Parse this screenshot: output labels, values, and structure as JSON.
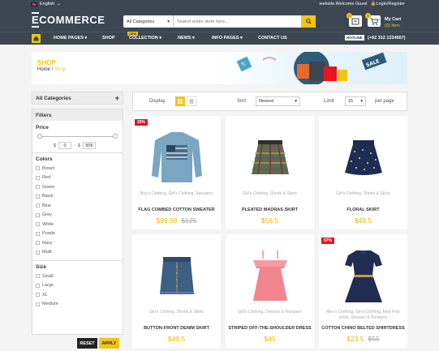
{
  "topbar": {
    "language": "English",
    "welcome": "website.Welcome Guest",
    "login": "Login/Register"
  },
  "header": {
    "logo": "COMMERCE",
    "search": {
      "category": "All Categories",
      "placeholder": "Search entire store here..."
    },
    "cart": {
      "label": "My Cart",
      "items": "(0) Item",
      "badge": "0"
    },
    "compare_badge": "0"
  },
  "nav": {
    "items": [
      "HOME PAGES",
      "SHOP",
      "COLLECTION",
      "NEWS",
      "INFO PAGES",
      "CONTACT US"
    ],
    "new_badge": "NEW",
    "hotline_label": "HOTLINE",
    "phone": "(+92 312 1234567)"
  },
  "banner": {
    "title": "SHOP",
    "breadcrumb": {
      "home": "Home",
      "sep": "/",
      "current": "Shop"
    },
    "sale_tag": "SALE"
  },
  "sidebar": {
    "categories_title": "All Categories",
    "filters_title": "Filters",
    "price": {
      "title": "Price",
      "currency": "$",
      "min": "0",
      "dash": "-",
      "max": "506"
    },
    "color": {
      "title": "Colors",
      "options": [
        "Brown",
        "Red",
        "Green",
        "Black",
        "Blue",
        "Grey",
        "White",
        "Purple",
        "Navy",
        "Multi"
      ]
    },
    "size": {
      "title": "Size",
      "options": [
        "Small",
        "Large",
        "XL",
        "Medium"
      ]
    },
    "reset_label": "RESET",
    "apply_label": "APPLY"
  },
  "toolbar": {
    "display_label": "Display",
    "sort_label": "Sort",
    "sort_value": "Newest",
    "limit_label": "Limit",
    "limit_value": "15",
    "per_page": "per page"
  },
  "products": [
    {
      "name": "FLAG COMBED COTTON SWEATER",
      "category": "Boy's Clothing, Girl's Clothing, Sweaters",
      "price": "$99.99",
      "old_price": "$125",
      "badge": "20%",
      "icon": "sweater-icon"
    },
    {
      "name": "PLEATED MADRAS SKIRT",
      "category": "Girl's Clothing, Shorts & Skirts",
      "price": "$56.5",
      "old_price": "",
      "badge": "",
      "icon": "plaid-skirt-icon"
    },
    {
      "name": "FLORAL SKIRT",
      "category": "Girl's Clothing, Shorts & Skirts",
      "price": "$49.5",
      "old_price": "",
      "badge": "",
      "icon": "floral-skirt-icon"
    },
    {
      "name": "BUTTON-FRONT DENIM SKIRT",
      "category": "Girl's Clothing, Shorts & Skirts",
      "price": "$49.5",
      "old_price": "",
      "badge": "",
      "icon": "denim-skirt-icon"
    },
    {
      "name": "STRIPED OFF-THE-SHOULDER DRESS",
      "category": "Girl's Clothing, Dresses & Rompers",
      "price": "$45",
      "old_price": "",
      "badge": "",
      "icon": "pink-dress-icon"
    },
    {
      "name": "COTTON CHINO BELTED SHIRTDRESS",
      "category": "Men's Clothing, Girl's Clothing, Men Polo shirts, Dresses & Rompers",
      "price": "$23.5",
      "old_price": "$55",
      "badge": "57%",
      "icon": "navy-dress-icon"
    }
  ],
  "colors": {
    "dark": "#3b4651",
    "accent": "#f0c419",
    "sale": "#e8141e"
  }
}
